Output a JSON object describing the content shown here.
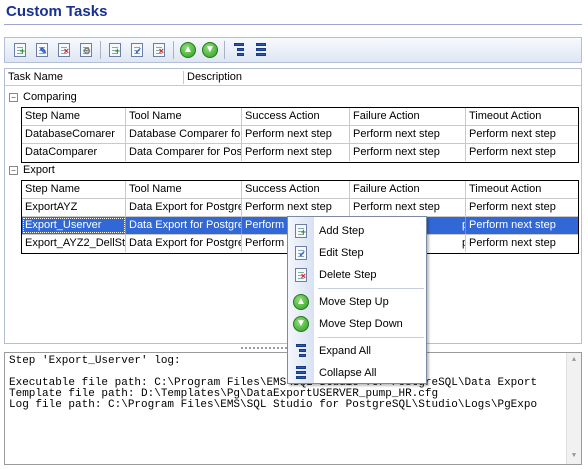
{
  "page": {
    "title": "Custom Tasks"
  },
  "toolbar": {
    "buttons": [
      {
        "name": "add-task-button",
        "icon": "add-task-icon"
      },
      {
        "name": "edit-task-button",
        "icon": "edit-task-icon"
      },
      {
        "name": "delete-task-button",
        "icon": "delete-task-icon"
      },
      {
        "name": "task-properties-button",
        "icon": "task-properties-icon"
      },
      {
        "name": "add-step-button",
        "icon": "add-step-icon"
      },
      {
        "name": "edit-step-button",
        "icon": "edit-step-icon"
      },
      {
        "name": "delete-step-button",
        "icon": "delete-step-icon"
      },
      {
        "name": "move-up-button",
        "icon": "arrow-up-icon"
      },
      {
        "name": "move-down-button",
        "icon": "arrow-down-icon"
      },
      {
        "name": "expand-all-button",
        "icon": "expand-all-icon"
      },
      {
        "name": "collapse-all-button",
        "icon": "collapse-all-icon"
      }
    ]
  },
  "tree": {
    "columns": [
      "Task Name",
      "Description"
    ],
    "step_columns": [
      "Step Name",
      "Tool Name",
      "Success Action",
      "Failure Action",
      "Timeout Action"
    ],
    "groups": [
      {
        "name": "Comparing",
        "expander": "−",
        "rows": [
          [
            "DatabaseComarer",
            "Database Comparer for",
            "Perform next step",
            "Perform next step",
            "Perform next step"
          ],
          [
            "DataComparer",
            "Data Comparer for Post",
            "Perform next step",
            "Perform next step",
            "Perform next step"
          ]
        ]
      },
      {
        "name": "Export",
        "expander": "−",
        "rows": [
          [
            "ExportAYZ",
            "Data Export for Postgre",
            "Perform next step",
            "Perform next step",
            "Perform next step"
          ],
          [
            "Export_Userver",
            "Data Export for Postgre",
            "Perform n",
            "p",
            "Perform next step"
          ],
          [
            "Export_AYZ2_DellSt",
            "Data Export for Postgre",
            "Perform n",
            "p",
            "Perform next step"
          ]
        ],
        "selected_row": 1
      }
    ]
  },
  "log": {
    "lines": [
      "Step 'Export_Userver' log:",
      "",
      "Executable file path: C:\\Program Files\\EMS\\SQL Studio for PostgreSQL\\Data Export",
      "Template file path: D:\\Templates\\Pg\\DataExportUSERVER_pump_HR.cfg",
      "Log file path: C:\\Program Files\\EMS\\SQL Studio for PostgreSQL\\Studio\\Logs\\PgExpo"
    ]
  },
  "context_menu": {
    "items": [
      {
        "label": "Add Step",
        "icon": "add-step-icon"
      },
      {
        "label": "Edit Step",
        "icon": "edit-step-icon"
      },
      {
        "label": "Delete Step",
        "icon": "delete-step-icon"
      },
      {
        "label": "Move Step Up",
        "icon": "arrow-up-icon"
      },
      {
        "label": "Move Step Down",
        "icon": "arrow-down-icon"
      },
      {
        "label": "Expand All",
        "icon": "expand-all-icon"
      },
      {
        "label": "Collapse All",
        "icon": "collapse-all-icon"
      }
    ]
  },
  "colors": {
    "title": "#17318f",
    "selection": "#3168d5",
    "accent_green": "#2f9a22",
    "accent_red": "#d0201a"
  }
}
